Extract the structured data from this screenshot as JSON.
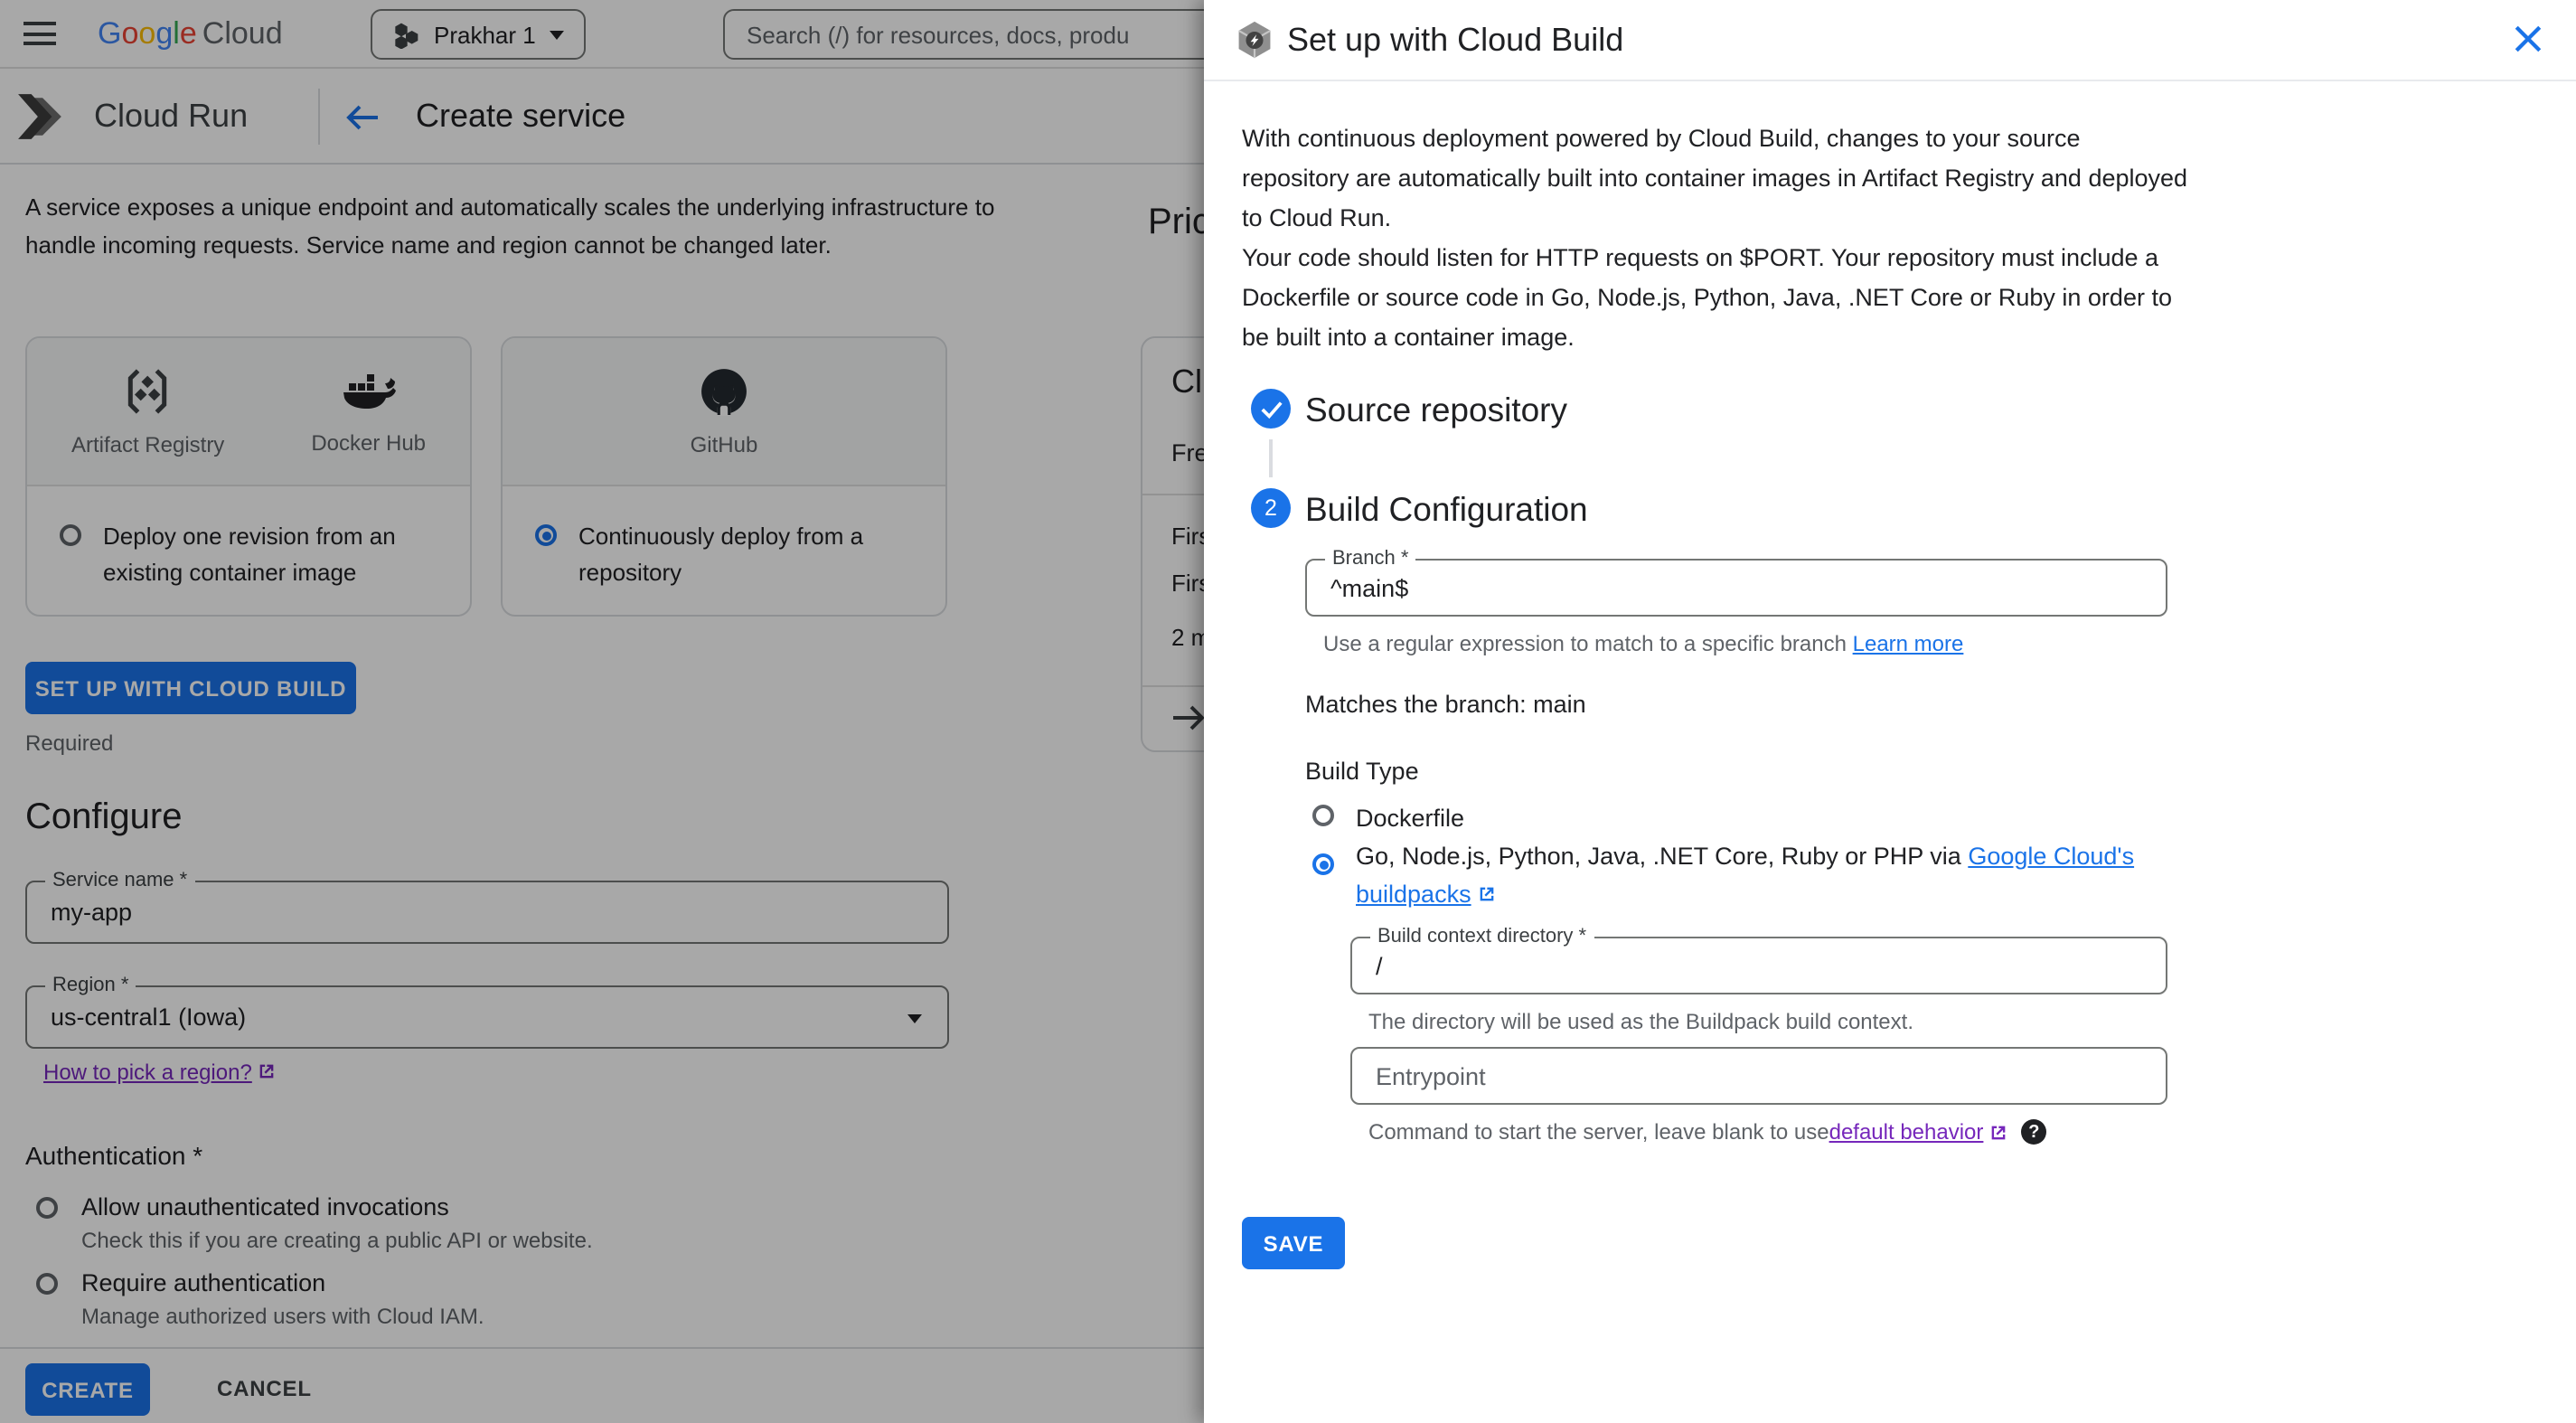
{
  "topbar": {
    "logo": {
      "google": "Google",
      "cloud": "Cloud"
    },
    "project_selector": {
      "label": "Prakhar 1"
    },
    "search": {
      "placeholder": "Search (/) for resources, docs, produ"
    }
  },
  "subheader": {
    "product": "Cloud Run",
    "page_title": "Create service"
  },
  "create_service": {
    "description": "A service exposes a unique endpoint and automatically scales the underlying infrastructure to handle incoming requests. Service name and region cannot be changed later.",
    "cards": {
      "registry": {
        "icon_labels": {
          "artifact_registry": "Artifact Registry",
          "docker_hub": "Docker Hub"
        },
        "option": "Deploy one revision from an existing container image"
      },
      "repository": {
        "icon_labels": {
          "github": "GitHub"
        },
        "option": "Continuously deploy from a repository"
      }
    },
    "setup_button": "SET UP WITH CLOUD BUILD",
    "required_note": "Required",
    "configure": {
      "heading": "Configure",
      "service_name": {
        "label": "Service name *",
        "value": "my-app"
      },
      "region": {
        "label": "Region *",
        "value": "us-central1 (Iowa)"
      },
      "region_link": "How to pick a region?"
    },
    "authentication": {
      "heading": "Authentication *",
      "options": [
        {
          "label": "Allow unauthenticated invocations",
          "description": "Check this if you are creating a public API or website."
        },
        {
          "label": "Require authentication",
          "description": "Manage authorized users with Cloud IAM."
        }
      ]
    },
    "footer": {
      "create": "CREATE",
      "cancel": "CANCEL"
    }
  },
  "pricing": {
    "heading_fragment": "Pric",
    "card": {
      "title_fragment": "Cl",
      "subtitle_fragment": "Fre",
      "line1_fragment": "Firs",
      "line2_fragment": "Firs",
      "line3_fragment": "2 m"
    }
  },
  "dialog": {
    "title": "Set up with Cloud Build",
    "intro_1": "With continuous deployment powered by Cloud Build, changes to your source repository are automatically built into container images in Artifact Registry and deployed to Cloud Run.",
    "intro_2": "Your code should listen for HTTP requests on $PORT. Your repository must include a Dockerfile or source code in Go, Node.js, Python, Java, .NET Core or Ruby in order to be built into a container image.",
    "steps": {
      "step1_title": "Source repository",
      "step2_number": "2",
      "step2_title": "Build Configuration"
    },
    "branch": {
      "label": "Branch *",
      "value": "^main$",
      "helper": "Use a regular expression to match to a specific branch ",
      "helper_link": "Learn more"
    },
    "matches_text": "Matches the branch: main",
    "build_type": {
      "heading": "Build Type",
      "option1": "Dockerfile",
      "option2_text": "Go, Node.js, Python, Java, .NET Core, Ruby or PHP via ",
      "option2_link": "Google Cloud's buildpacks"
    },
    "build_context": {
      "label": "Build context directory *",
      "value": "/",
      "helper": "The directory will be used as the Buildpack build context."
    },
    "entrypoint": {
      "placeholder": "Entrypoint",
      "helper": "Command to start the server, leave blank to use ",
      "helper_link": "default behavior",
      "help_icon": "?"
    },
    "save_button": "SAVE"
  }
}
